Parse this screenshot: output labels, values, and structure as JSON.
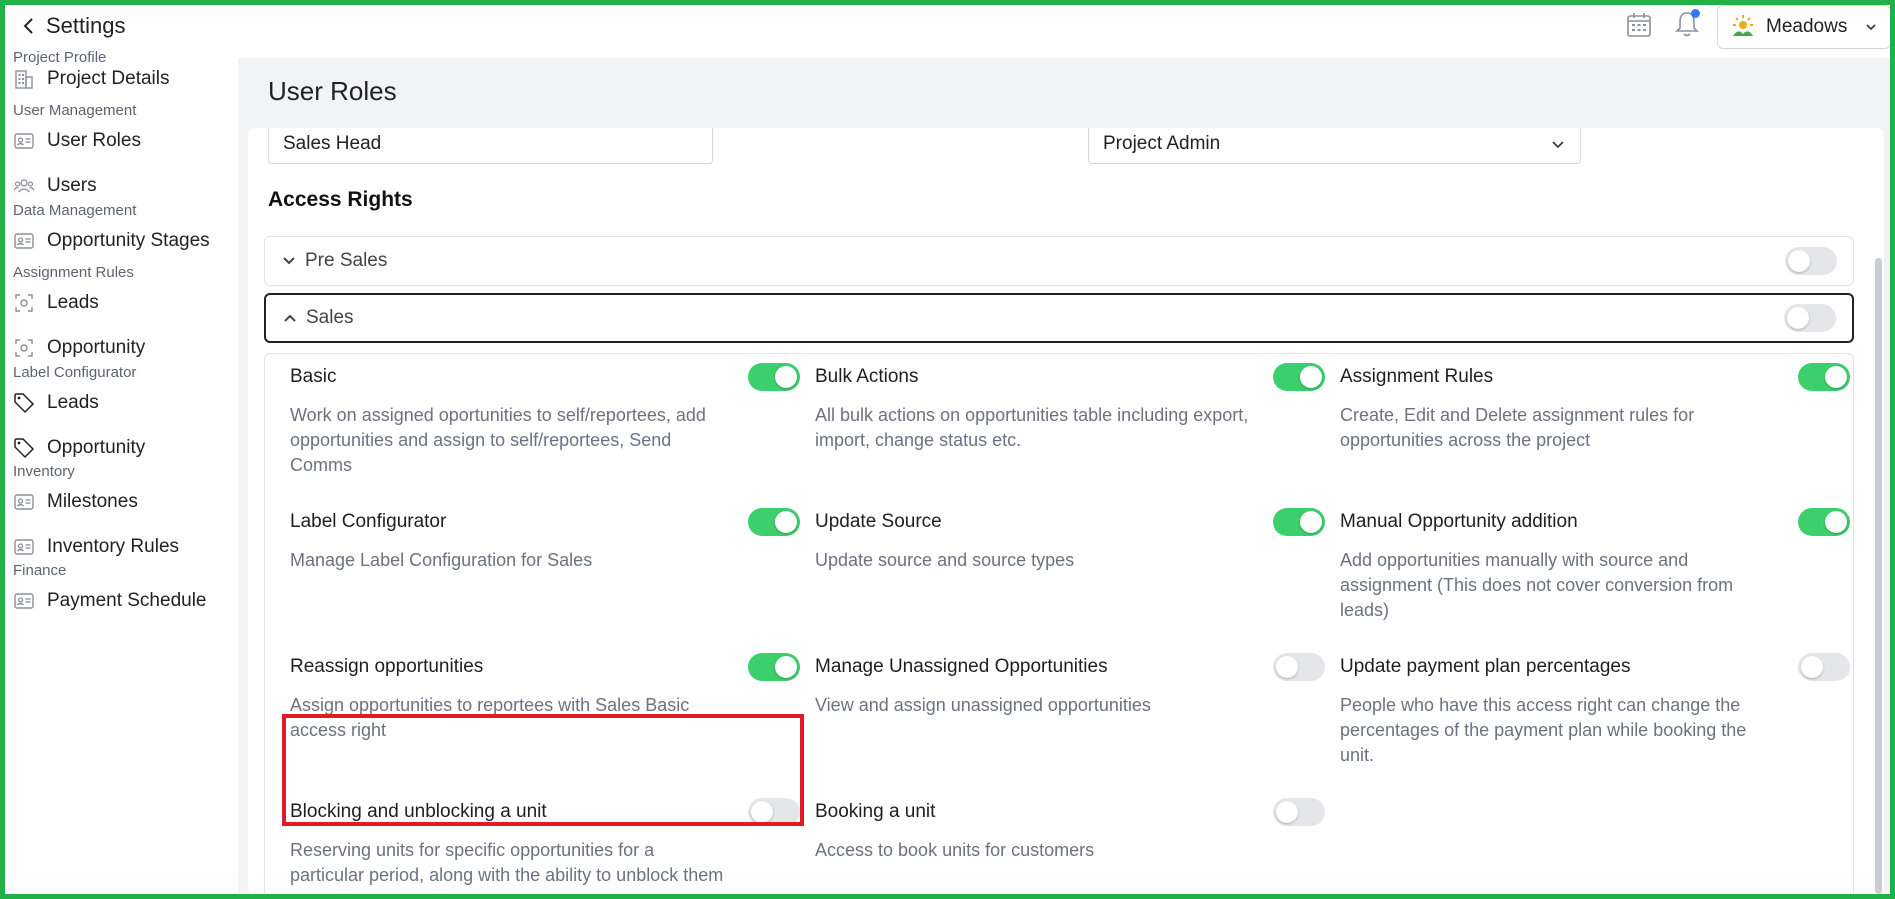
{
  "header": {
    "back_label": "Settings",
    "project_name": "Meadows"
  },
  "sidebar": {
    "sections": [
      {
        "label": "Project Profile"
      },
      {
        "label": "User Management"
      },
      {
        "label": "Data Management"
      },
      {
        "label": "Assignment Rules"
      },
      {
        "label": "Label Configurator"
      },
      {
        "label": "Inventory"
      },
      {
        "label": "Finance"
      }
    ],
    "items": [
      {
        "label": "Project Details",
        "icon": "building-icon"
      },
      {
        "label": "User Roles",
        "icon": "id-card-icon"
      },
      {
        "label": "Users",
        "icon": "users-icon"
      },
      {
        "label": "Opportunity Stages",
        "icon": "id-card-icon"
      },
      {
        "label": "Leads",
        "icon": "focus-icon"
      },
      {
        "label": "Opportunity",
        "icon": "focus-icon"
      },
      {
        "label": "Leads",
        "icon": "tag-icon"
      },
      {
        "label": "Opportunity",
        "icon": "tag-icon"
      },
      {
        "label": "Milestones",
        "icon": "id-card-icon"
      },
      {
        "label": "Inventory Rules",
        "icon": "id-card-icon"
      },
      {
        "label": "Payment Schedule",
        "icon": "id-card-icon"
      }
    ]
  },
  "main": {
    "title": "User Roles",
    "role_name_value": "Sales Head",
    "reports_to_value": "Project Admin",
    "access_rights_title": "Access Rights",
    "accordions": [
      {
        "label": "Pre Sales",
        "expanded": false,
        "enabled": false
      },
      {
        "label": "Sales",
        "expanded": true,
        "enabled": false
      }
    ],
    "permissions": [
      {
        "title": "Basic",
        "desc": "Work on assigned oportunities to self/reportees, add opportunities and assign to self/reportees, Send Comms",
        "on": true
      },
      {
        "title": "Bulk Actions",
        "desc": "All bulk actions on opportunities table including export, import, change status etc.",
        "on": true
      },
      {
        "title": "Assignment Rules",
        "desc": "Create, Edit and Delete assignment rules for opportunities across the project",
        "on": true
      },
      {
        "title": "Label Configurator",
        "desc": "Manage Label Configuration for Sales",
        "on": true
      },
      {
        "title": "Update Source",
        "desc": "Update source and source types",
        "on": true
      },
      {
        "title": "Manual Opportunity addition",
        "desc": "Add opportunities manually with source and assignment (This does not cover conversion from leads)",
        "on": true
      },
      {
        "title": "Reassign opportunities",
        "desc": "Assign opportunities to reportees with Sales Basic access right",
        "on": true
      },
      {
        "title": "Manage Unassigned Opportunities",
        "desc": "View and assign unassigned opportunities",
        "on": false
      },
      {
        "title": "Update payment plan percentages",
        "desc": "People who have this access right can change the percentages of the payment plan while booking the unit.",
        "on": false
      },
      {
        "title": "Blocking and unblocking a unit",
        "desc": "Reserving units for specific opportunities for a particular period, along with the ability to unblock them",
        "on": false
      },
      {
        "title": "Booking a unit",
        "desc": "Access to book units for customers",
        "on": false
      }
    ]
  },
  "colors": {
    "toggle_on": "#3ccf6b",
    "toggle_off": "#e4e6ea",
    "frame": "#22b04a",
    "highlight": "#e01b24"
  }
}
